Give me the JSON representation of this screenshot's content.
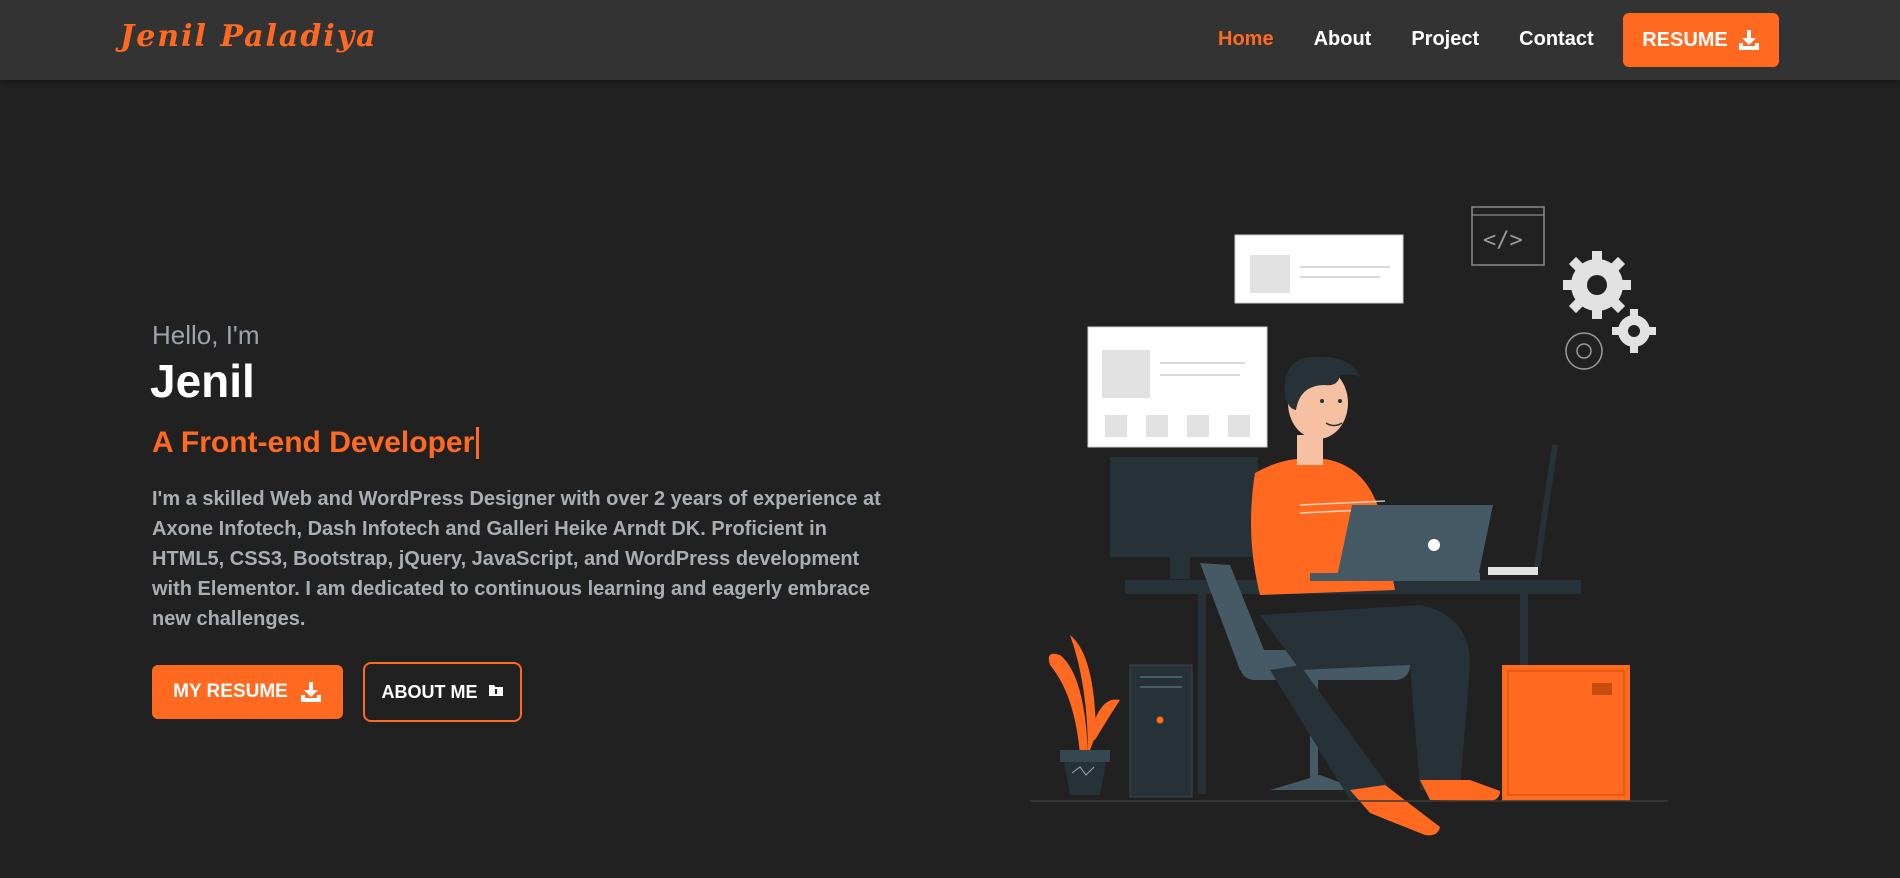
{
  "brand": {
    "name": "Jenil Paladiya"
  },
  "nav": {
    "items": [
      {
        "label": "Home",
        "active": true
      },
      {
        "label": "About",
        "active": false
      },
      {
        "label": "Project",
        "active": false
      },
      {
        "label": "Contact",
        "active": false
      }
    ],
    "resume_label": "RESUME"
  },
  "hero": {
    "greeting": "Hello, I'm",
    "name": "Jenil",
    "role": "A Front-end Developer",
    "description": "I'm a skilled Web and WordPress Designer with over 2 years of experience at Axone Infotech, Dash Infotech and Galleri Heike Arndt DK. Proficient in HTML5, CSS3, Bootstrap, jQuery, JavaScript, and WordPress development with Elementor. I am dedicated to continuous learning and eagerly embrace new challenges.",
    "primary_button": "MY RESUME",
    "secondary_button": "ABOUT ME"
  },
  "icons": {
    "resume": "download-icon",
    "about": "folder-icon"
  },
  "colors": {
    "accent": "#ff6a20",
    "background": "#212121",
    "navbar": "#333333",
    "muted_text": "#a9aeb5"
  }
}
